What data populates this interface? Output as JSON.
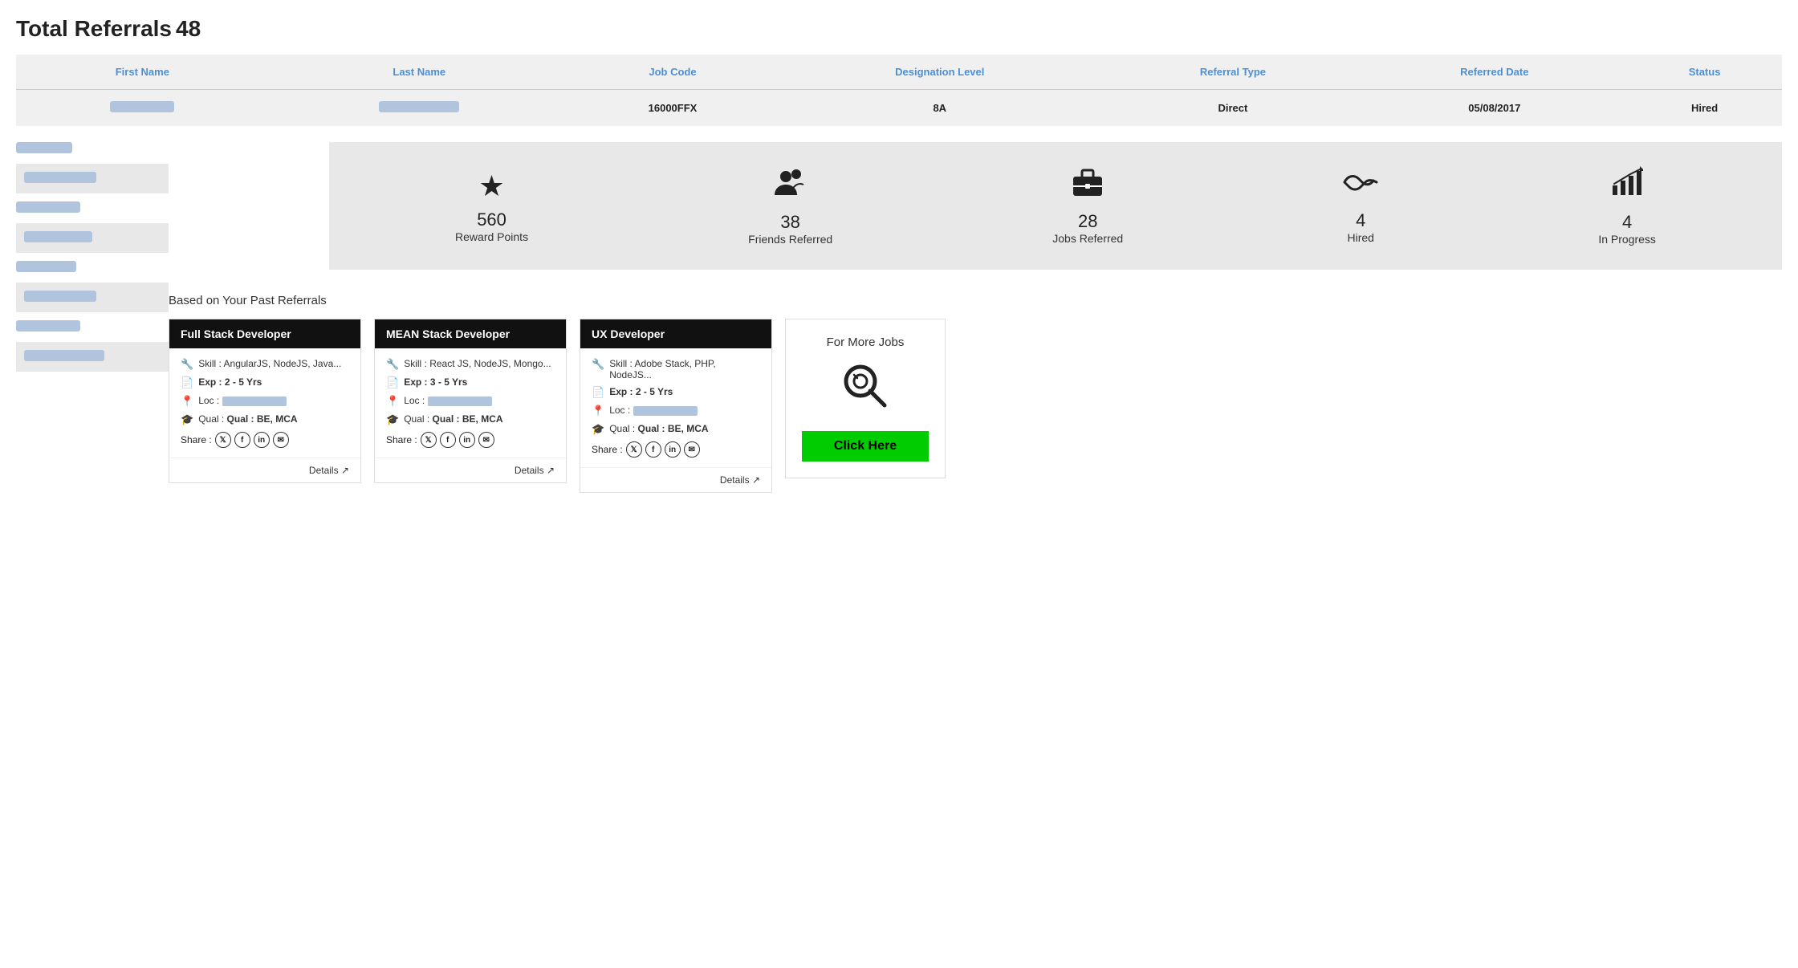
{
  "header": {
    "total_referrals_label": "Total Referrals",
    "total_referrals_value": "48"
  },
  "table": {
    "columns": [
      "First Name",
      "Last Name",
      "Job Code",
      "Designation Level",
      "Referral Type",
      "Referred Date",
      "Status"
    ],
    "rows": [
      {
        "first_name": "",
        "last_name": "",
        "job_code": "16000FFX",
        "designation_level": "8A",
        "referral_type": "Direct",
        "referred_date": "05/08/2017",
        "status": "Hired"
      }
    ]
  },
  "stats": [
    {
      "icon": "★",
      "value": "560",
      "label": "Reward Points"
    },
    {
      "icon": "👥",
      "value": "38",
      "label": "Friends Referred"
    },
    {
      "icon": "💼",
      "value": "28",
      "label": "Jobs Referred"
    },
    {
      "icon": "🤝",
      "value": "4",
      "label": "Hired"
    },
    {
      "icon": "📈",
      "value": "4",
      "label": "In Progress"
    }
  ],
  "past_referrals_label": "Based on Your Past Referrals",
  "job_cards": [
    {
      "title": "Full Stack Developer",
      "skill": "Skill : AngularJS, NodeJS, Java...",
      "exp": "Exp : 2 - 5 Yrs",
      "qual": "Qual : BE, MCA",
      "details_label": "Details"
    },
    {
      "title": "MEAN Stack Developer",
      "skill": "Skill : React JS, NodeJS, Mongo...",
      "exp": "Exp : 3 - 5 Yrs",
      "qual": "Qual : BE, MCA",
      "details_label": "Details"
    },
    {
      "title": "UX Developer",
      "skill": "Skill : Adobe Stack, PHP, NodeJS...",
      "exp": "Exp : 2 - 5 Yrs",
      "qual": "Qual : BE, MCA",
      "details_label": "Details"
    }
  ],
  "more_jobs": {
    "title": "For More Jobs",
    "button_label": "Click Here"
  },
  "share_label": "Share :"
}
